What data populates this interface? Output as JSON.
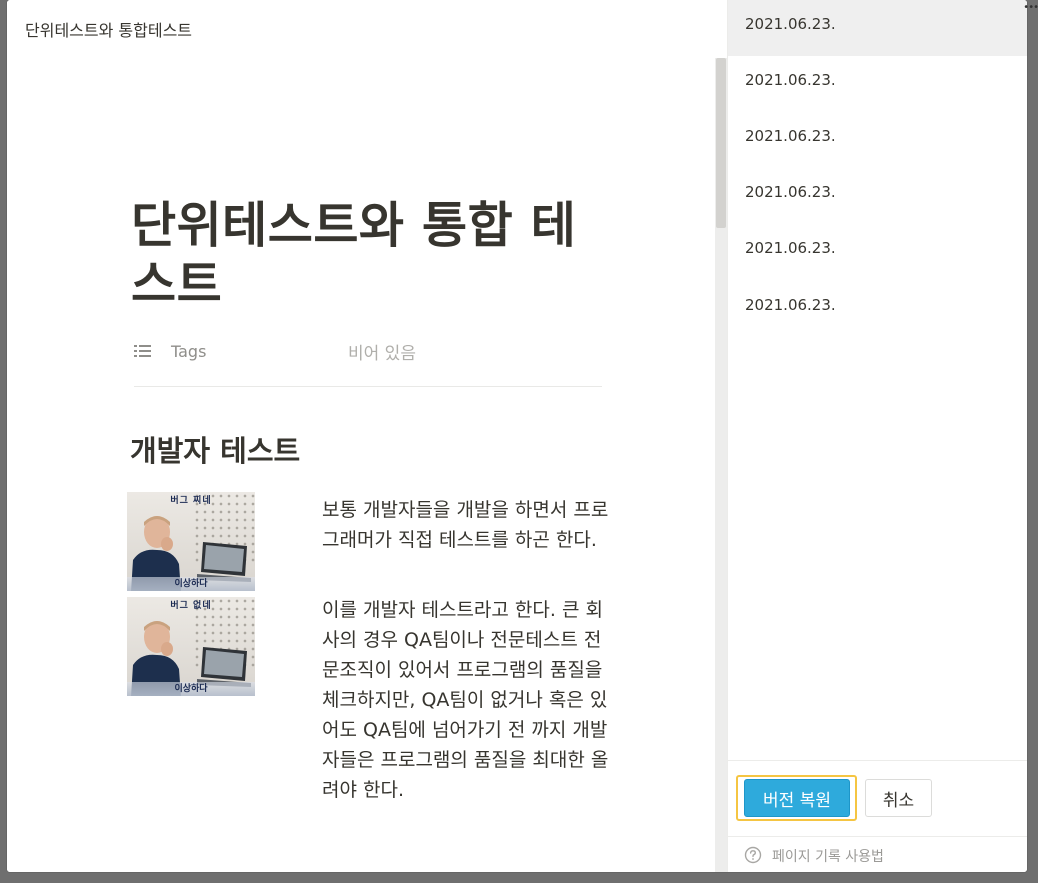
{
  "breadcrumb": "단위테스트와 통합테스트",
  "page": {
    "title": "단위테스트와 통합 테스트",
    "property": {
      "icon": "list-icon",
      "name": "Tags",
      "value": "비어 있음"
    },
    "section_heading": "개발자 테스트",
    "memes": [
      {
        "top_caption": "버그 찌네",
        "bottom_caption": "이상하다"
      },
      {
        "top_caption": "버그 없네",
        "bottom_caption": "이상하다"
      }
    ],
    "paragraphs": [
      "보통 개발자들을 개발을 하면서 프로그래머가 직접 테스트를 하곤 한다.",
      "이를 개발자 테스트라고 한다. 큰 회사의 경우 QA팀이나 전문테스트 전문조직이 있어서 프로그램의 품질을 체크하지만, QA팀이 없거나 혹은 있어도 QA팀에 넘어가기 전 까지 개발자들은 프로그램의 품질을 최대한 올려야 한다."
    ]
  },
  "history": {
    "versions": [
      {
        "date": "2021.06.23.",
        "selected": true
      },
      {
        "date": "2021.06.23.",
        "selected": false
      },
      {
        "date": "2021.06.23.",
        "selected": false
      },
      {
        "date": "2021.06.23.",
        "selected": false
      },
      {
        "date": "2021.06.23.",
        "selected": false
      },
      {
        "date": "2021.06.23.",
        "selected": false
      }
    ],
    "restore_label": "버전 복원",
    "cancel_label": "취소",
    "help_label": "페이지 기록 사용법"
  },
  "colors": {
    "accent": "#2eaadc",
    "focus_ring": "#f5c542",
    "selected_row": "#efefef",
    "text": "#37352f",
    "muted": "#9b9a97"
  }
}
